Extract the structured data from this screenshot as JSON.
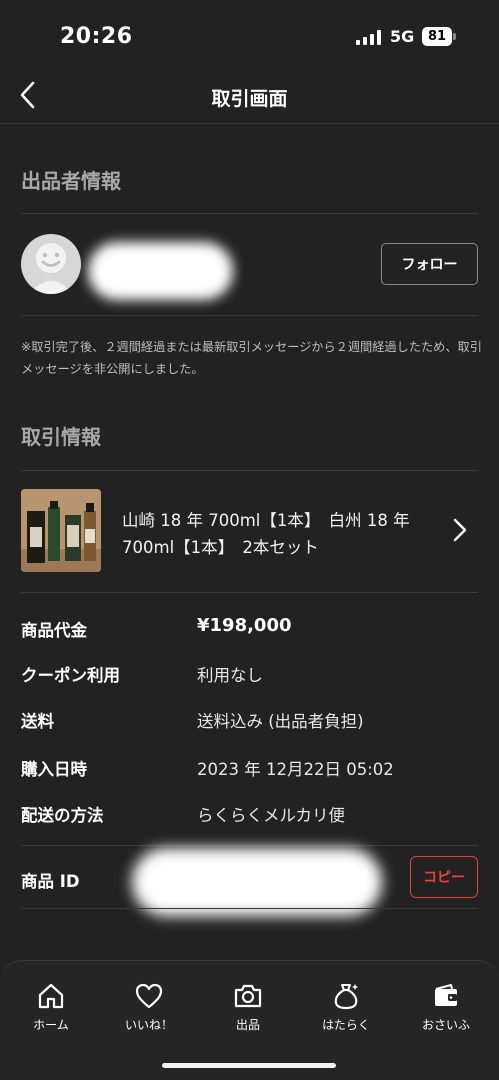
{
  "status_bar": {
    "time": "20:26",
    "network": "5G",
    "battery": "81"
  },
  "nav": {
    "title": "取引画面"
  },
  "seller_section": {
    "title": "出品者情報",
    "follow_label": "フォロー"
  },
  "notice": "※取引完了後、２週間経過または最新取引メッセージから２週間経過したため、取引メッセージを非公開にしました。",
  "transaction_section": {
    "title": "取引情報",
    "item_title": "山崎 18 年 700ml【1本】　白州 18 年 700ml【1本】　2本セット"
  },
  "details": {
    "price_label": "商品代金",
    "price_value": "¥198,000",
    "coupon_label": "クーポン利用",
    "coupon_value": "利用なし",
    "shipping_fee_label": "送料",
    "shipping_fee_value": "送料込み (出品者負担)",
    "purchase_date_label": "購入日時",
    "purchase_date_value": "2023 年 12月22日 05:02",
    "shipping_method_label": "配送の方法",
    "shipping_method_value": "らくらくメルカリ便",
    "item_id_label": "商品 ID",
    "copy_label": "コピー"
  },
  "tabs": [
    {
      "label": "ホーム",
      "icon": "home-icon"
    },
    {
      "label": "いいね！",
      "icon": "heart-icon"
    },
    {
      "label": "出品",
      "icon": "camera-icon"
    },
    {
      "label": "はたらく",
      "icon": "money-bag-icon"
    },
    {
      "label": "おさいふ",
      "icon": "wallet-icon"
    }
  ],
  "colors": {
    "background": "#222222",
    "accent": "#e8423d"
  }
}
